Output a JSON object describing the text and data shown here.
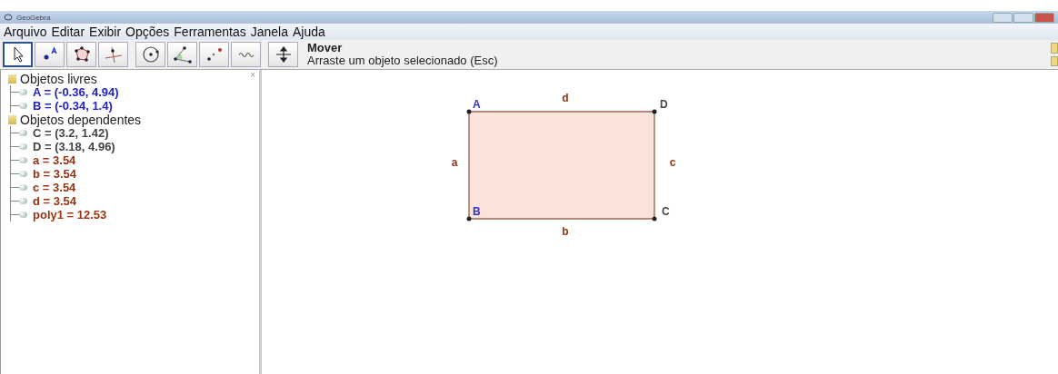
{
  "window": {
    "title": "GeoGebra"
  },
  "menu": [
    "Arquivo",
    "Editar",
    "Exibir",
    "Opções",
    "Ferramentas",
    "Janela",
    "Ajuda"
  ],
  "toolbar": {
    "tools": [
      {
        "kind": "pointer",
        "selected": true
      },
      {
        "kind": "point",
        "selected": false
      },
      {
        "kind": "polygon",
        "selected": false
      },
      {
        "kind": "perpendicular",
        "selected": false
      },
      {
        "kind": "circle",
        "selected": false
      },
      {
        "kind": "angle",
        "selected": false
      },
      {
        "kind": "reflect",
        "selected": false
      },
      {
        "kind": "text",
        "selected": false
      },
      {
        "kind": "pan",
        "selected": false
      }
    ],
    "tool_name": "Mover",
    "tool_help": "Arraste um objeto selecionado (Esc)"
  },
  "algebra": {
    "close": "×",
    "groups": [
      {
        "label": "Objetos livres",
        "children": [
          {
            "text": "A = (-0.36, 4.94)",
            "color": "#2222cc"
          },
          {
            "text": "B = (-0.34, 1.4)",
            "color": "#2222cc"
          }
        ]
      },
      {
        "label": "Objetos dependentes",
        "children": [
          {
            "text": "C = (3.2, 1.42)",
            "color": "#444444"
          },
          {
            "text": "D = (3.18, 4.96)",
            "color": "#444444"
          },
          {
            "text": "a = 3.54",
            "color": "#993311"
          },
          {
            "text": "b = 3.54",
            "color": "#993311"
          },
          {
            "text": "c = 3.54",
            "color": "#993311"
          },
          {
            "text": "d = 3.54",
            "color": "#993311"
          },
          {
            "text": "poly1 = 12.53",
            "color": "#993311"
          }
        ]
      }
    ]
  },
  "canvas": {
    "points": [
      {
        "label": "A",
        "color": "#3333cc"
      },
      {
        "label": "D",
        "color": "#444444"
      },
      {
        "label": "B",
        "color": "#3333cc"
      },
      {
        "label": "C",
        "color": "#444444"
      }
    ],
    "segments": [
      {
        "label": "a"
      },
      {
        "label": "b"
      },
      {
        "label": "c"
      },
      {
        "label": "d"
      }
    ]
  }
}
